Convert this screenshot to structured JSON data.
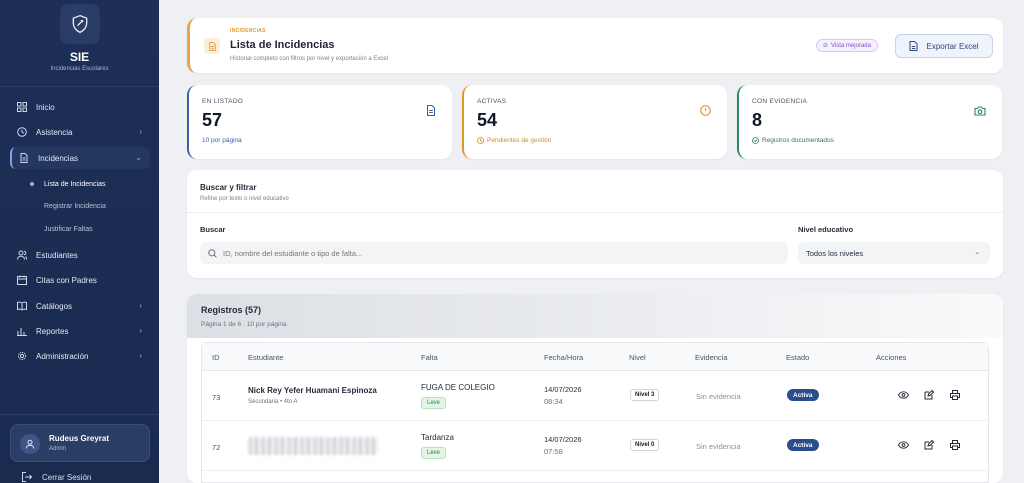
{
  "sidebar": {
    "brand_title": "SIE",
    "brand_subtitle": "Incidencias Escolares",
    "nav": [
      {
        "label": "Inicio",
        "icon": "grid-icon"
      },
      {
        "label": "Asistencia",
        "icon": "clock-icon"
      },
      {
        "label": "Incidencias",
        "icon": "document-icon"
      },
      {
        "label": "Estudiantes",
        "icon": "users-icon"
      },
      {
        "label": "Citas con Padres",
        "icon": "calendar-icon"
      },
      {
        "label": "Catálogos",
        "icon": "book-icon"
      },
      {
        "label": "Reportes",
        "icon": "chart-icon"
      },
      {
        "label": "Administración",
        "icon": "gear-icon"
      }
    ],
    "subnav": [
      {
        "label": "Lista de Incidencias"
      },
      {
        "label": "Registrar Incidencia"
      },
      {
        "label": "Justificar Faltas"
      }
    ],
    "user": {
      "name": "Rudeus Greyrat",
      "role": "Admin"
    },
    "logout_label": "Cerrar Sesión"
  },
  "header": {
    "eyebrow": "INCIDENCIAS",
    "title": "Lista de Incidencias",
    "subtitle": "Historial completo con filtros por nivel y exportación a Excel",
    "badge": "Vista mejorada",
    "export_label": "Exportar Excel"
  },
  "stats": [
    {
      "label": "EN LISTADO",
      "value": "57",
      "note": "10 por página",
      "color": "#3b5ea8"
    },
    {
      "label": "ACTIVAS",
      "value": "54",
      "note": "Pendientes de gestión",
      "color": "#e0962f"
    },
    {
      "label": "CON EVIDENCIA",
      "value": "8",
      "note": "Registros documentados",
      "color": "#2f8a5b"
    }
  ],
  "filters": {
    "title": "Buscar y filtrar",
    "subtitle": "Refine por texto o nivel educativo",
    "search_label": "Buscar",
    "search_placeholder": "ID, nombre del estudiante o tipo de falta...",
    "level_label": "Nivel educativo",
    "level_value": "Todos los niveles"
  },
  "table": {
    "title": "Registros (57)",
    "subtitle": "Página 1 de 6 · 10 por página",
    "columns": [
      "ID",
      "Estudiante",
      "Falta",
      "Fecha/Hora",
      "Nivel",
      "Evidencia",
      "Estado",
      "Acciones"
    ],
    "rows": [
      {
        "id": "73",
        "student": "Nick Rey Yefer Huamani Espinoza",
        "meta": "Secundaria • 4to A",
        "falta": "FUGA DE COLEGIO",
        "tipo": "Leve",
        "fecha": "14/07/2026",
        "hora": "08:34",
        "nivel": "Nivel 3",
        "evidencia": "Sin evidencia",
        "estado": "Activa"
      },
      {
        "id": "72",
        "student": "",
        "meta": "",
        "falta": "Tardanza",
        "tipo": "Leve",
        "fecha": "14/07/2026",
        "hora": "07:58",
        "nivel": "Nivel 0",
        "evidencia": "Sin evidencia",
        "estado": "Activa"
      }
    ]
  }
}
